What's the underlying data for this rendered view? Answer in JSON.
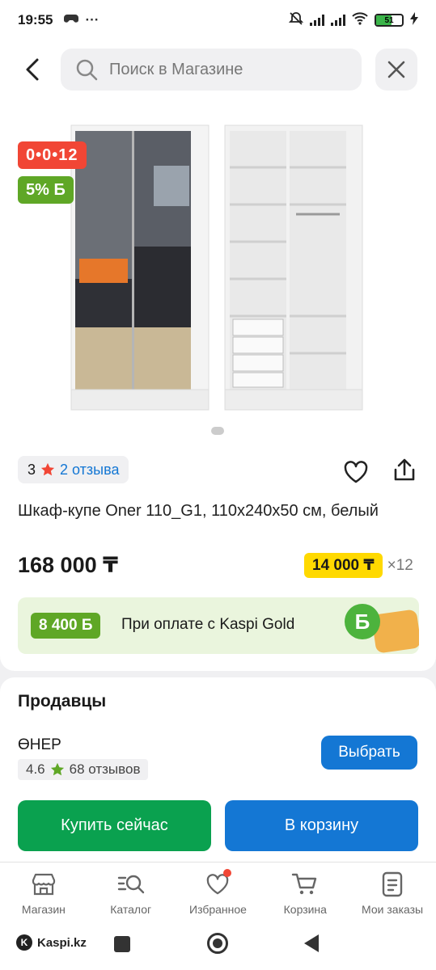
{
  "status_bar": {
    "time": "19:55",
    "battery": "51"
  },
  "search": {
    "placeholder": "Поиск в Магазине"
  },
  "product": {
    "timer_badge": "0•0•12",
    "bonus_badge": "5% Б",
    "rating": "3",
    "reviews_label": "2 отзыва",
    "title": "Шкаф-купе Oner 110_G1, 110х240х50 см, белый",
    "price": "168 000 ₸",
    "installment_amount": "14 000 ₸",
    "installment_months": "×12"
  },
  "gold_banner": {
    "bonus": "8 400 Б",
    "text": "При оплате с Kaspi Gold",
    "coin": "Б"
  },
  "sellers": {
    "heading": "Продавцы",
    "seller_name": "ӨНЕР",
    "seller_rating": "4.6",
    "seller_reviews": "68 отзывов",
    "select_label": "Выбрать"
  },
  "actions": {
    "buy_now": "Купить сейчас",
    "to_cart": "В корзину"
  },
  "bottom_nav": [
    {
      "label": "Магазин",
      "icon": "store-icon"
    },
    {
      "label": "Каталог",
      "icon": "catalog-search-icon"
    },
    {
      "label": "Избранное",
      "icon": "heart-icon"
    },
    {
      "label": "Корзина",
      "icon": "cart-icon"
    },
    {
      "label": "Мои заказы",
      "icon": "orders-icon"
    }
  ],
  "system_nav": {
    "brand": "Kaspi.kz"
  },
  "colors": {
    "accent_blue": "#1477d4",
    "buy_green": "#0aa14f",
    "bonus_green": "#5fa726",
    "timer_red": "#f14635",
    "installment_yellow": "#ffd900"
  }
}
